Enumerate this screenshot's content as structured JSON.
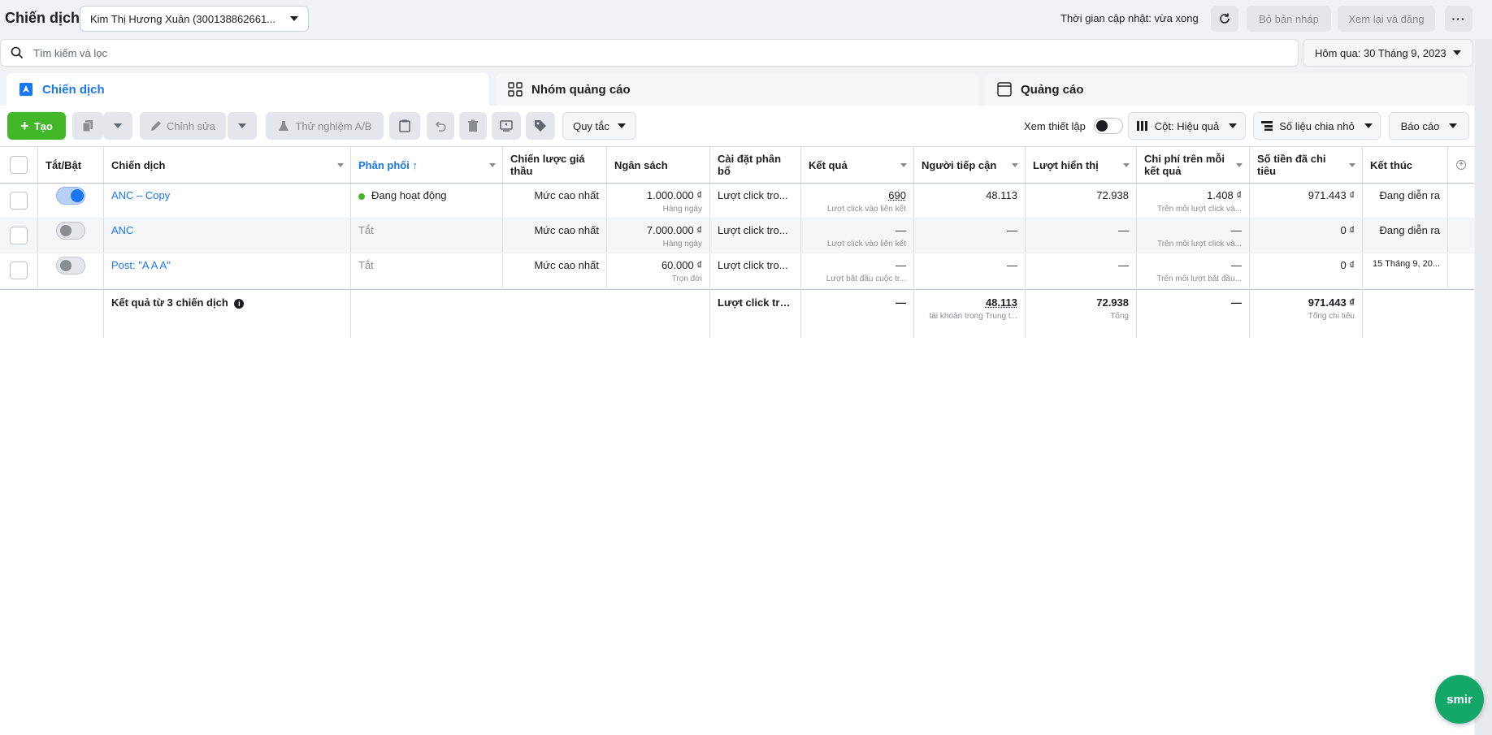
{
  "header": {
    "title": "Chiến dịch",
    "account": "Kim Thị Hương Xuân (300138862661...",
    "update_status": "Thời gian cập nhật: vừa xong",
    "discard_draft": "Bỏ bản nháp",
    "review_publish": "Xem lại và đăng"
  },
  "search": {
    "placeholder": "Tìm kiếm và lọc",
    "date_range": "Hôm qua: 30 Tháng 9, 2023"
  },
  "tabs": [
    {
      "label": "Chiến dịch"
    },
    {
      "label": "Nhóm quảng cáo"
    },
    {
      "label": "Quảng cáo"
    }
  ],
  "toolbar": {
    "create": "Tạo",
    "edit": "Chỉnh sửa",
    "ab_test": "Thử nghiệm A/B",
    "rules": "Quy tắc",
    "view_settings": "Xem thiết lập",
    "columns": "Cột: Hiệu quả",
    "breakdown": "Số liệu chia nhỏ",
    "reports": "Báo cáo"
  },
  "table": {
    "headers": {
      "toggle": "Tắt/Bật",
      "campaign": "Chiến dịch",
      "delivery": "Phân phối ↑",
      "bid_strategy": "Chiến lược giá thầu",
      "budget": "Ngân sách",
      "attribution": "Cài đặt phân bổ",
      "results": "Kết quả",
      "reach": "Người tiếp cận",
      "impressions": "Lượt hiển thị",
      "cost_per_result": "Chi phí trên mỗi kết quả",
      "amount_spent": "Số tiền đã chi tiêu",
      "ends": "Kết thúc"
    },
    "rows": [
      {
        "name": "ANC – Copy",
        "delivery": "Đang hoạt động",
        "bid": "Mức cao nhất",
        "budget": "1.000.000 ₫",
        "budget_type": "Hàng ngày",
        "attribution": "Lượt click tro...",
        "results": "690",
        "results_type": "Lượt click vào liên kết",
        "reach": "48.113",
        "impressions": "72.938",
        "cpr": "1.408 ₫",
        "cpr_type": "Trên mỗi lượt click và...",
        "spent": "971.443 ₫",
        "ends": "Đang diễn ra"
      },
      {
        "name": "ANC",
        "delivery": "Tắt",
        "bid": "Mức cao nhất",
        "budget": "7.000.000 ₫",
        "budget_type": "Hàng ngày",
        "attribution": "Lượt click tro...",
        "results": "—",
        "results_type": "Lượt click vào liên kết",
        "reach": "—",
        "impressions": "—",
        "cpr": "—",
        "cpr_type": "Trên mỗi lượt click và...",
        "spent": "0 ₫",
        "ends": "Đang diễn ra"
      },
      {
        "name": "Post: \"A A A\"",
        "delivery": "Tắt",
        "bid": "Mức cao nhất",
        "budget": "60.000 ₫",
        "budget_type": "Trọn đời",
        "attribution": "Lượt click tro...",
        "results": "—",
        "results_type": "Lượt bắt đầu cuộc tr...",
        "reach": "—",
        "impressions": "—",
        "cpr": "—",
        "cpr_type": "Trên mỗi lượt bắt đầu...",
        "spent": "0 ₫",
        "ends": "15 Tháng 9, 20..."
      }
    ],
    "summary": {
      "label": "Kết quả từ 3 chiến dịch",
      "attribution": "Lượt click tro...",
      "results": "—",
      "reach": "48.113",
      "reach_sub": "tài khoản trong Trung t...",
      "impressions": "72.938",
      "impressions_sub": "Tổng",
      "cpr": "—",
      "spent": "971.443 ₫",
      "spent_sub": "Tổng chi tiêu"
    }
  },
  "widget": {
    "label": "smir"
  }
}
